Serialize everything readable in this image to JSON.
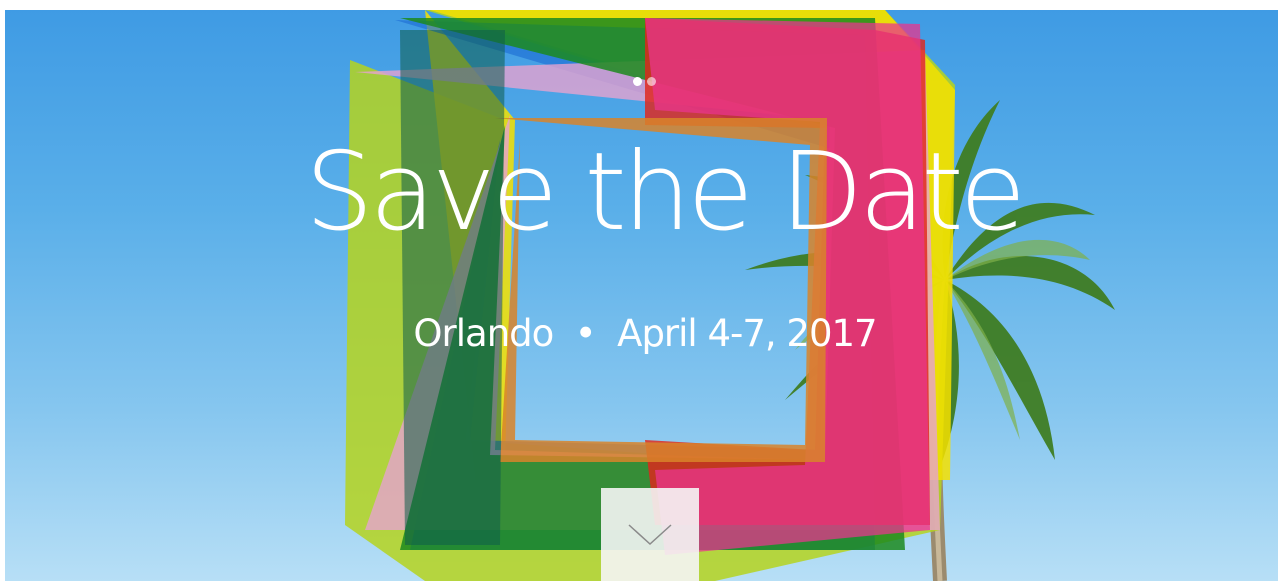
{
  "hero": {
    "title": "Save the Date",
    "subtitle": "Orlando  •  April 4-7, 2017",
    "colors": {
      "sky_top": "#3f9be4",
      "sky_bottom": "#b7dff6",
      "frame_red": "#e0261b",
      "frame_yellow": "#f4e100",
      "frame_lime": "#b5d41e",
      "frame_green": "#1c8a1f",
      "frame_magenta": "#e8358e",
      "frame_blue": "#2172d6",
      "frame_pink": "#e6a3cf",
      "frame_orange": "#d8842a",
      "text": "#ffffff",
      "button_bg": "#f5f5f5"
    }
  },
  "carousel": {
    "slide_count": 2,
    "active_index": 0
  },
  "icons": {
    "scroll_down": "chevron-down-icon",
    "palm_tree": "palm-tree-image"
  }
}
